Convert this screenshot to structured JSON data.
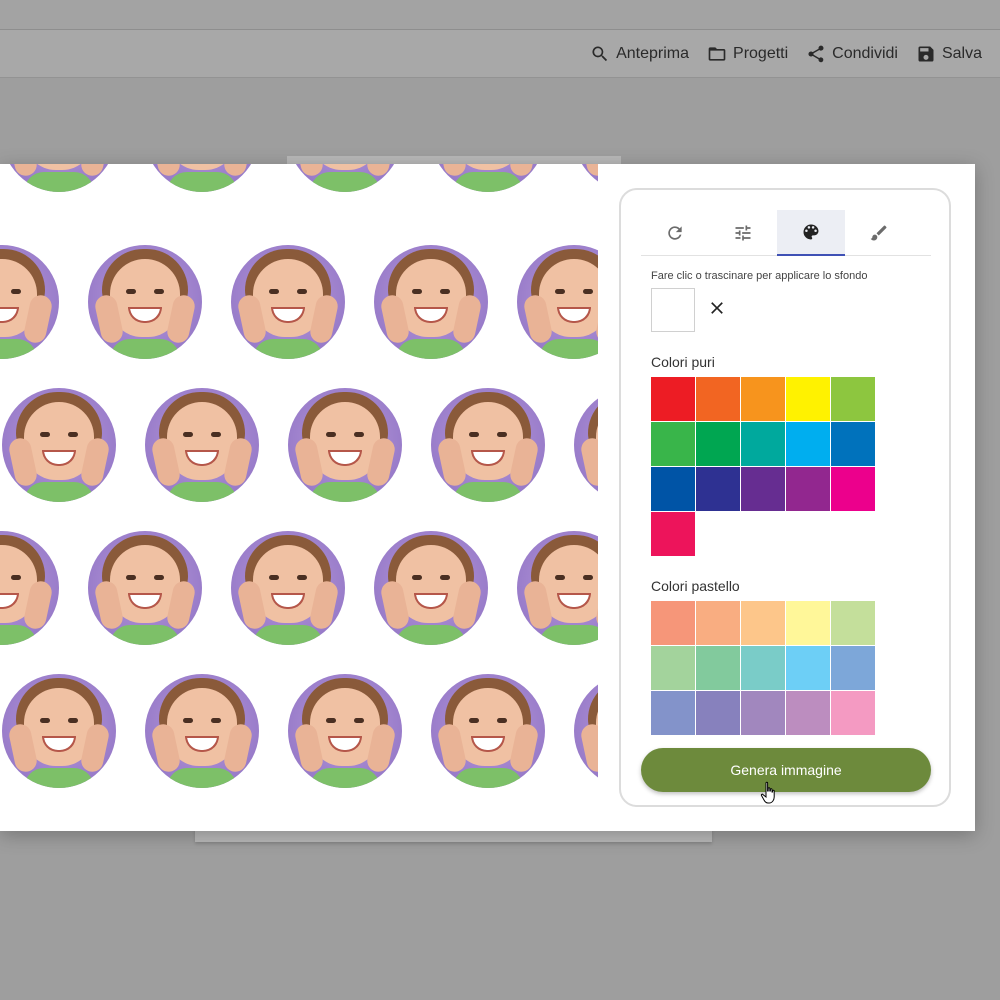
{
  "toolbar": {
    "preview_label": "Anteprima",
    "projects_label": "Progetti",
    "share_label": "Condividi",
    "save_label": "Salva"
  },
  "panel": {
    "tabs": [
      {
        "icon": "refresh-icon"
      },
      {
        "icon": "sliders-icon"
      },
      {
        "icon": "palette-icon",
        "active": true
      },
      {
        "icon": "brush-icon"
      }
    ],
    "hint": "Fare clic o trascinare per applicare lo sfondo",
    "pure_colors_title": "Colori puri",
    "pure_colors": [
      "#ed1c24",
      "#f26522",
      "#f7941d",
      "#fff200",
      "#8dc63f",
      "#39b54a",
      "#00a651",
      "#00a99d",
      "#00aeef",
      "#0072bc",
      "#0054a6",
      "#2e3192",
      "#662d91",
      "#92278f",
      "#ec008c",
      "#ed145b"
    ],
    "pastel_colors_title": "Colori pastello",
    "pastel_colors": [
      "#f69679",
      "#f9ad81",
      "#fdc68a",
      "#fff799",
      "#c4df9b",
      "#a3d39c",
      "#82ca9d",
      "#7accc8",
      "#6dcff6",
      "#7da7d9",
      "#8393ca",
      "#8781bd",
      "#a187be",
      "#bc8dbf",
      "#f49ac2"
    ],
    "generate_label": "Genera immagine"
  }
}
